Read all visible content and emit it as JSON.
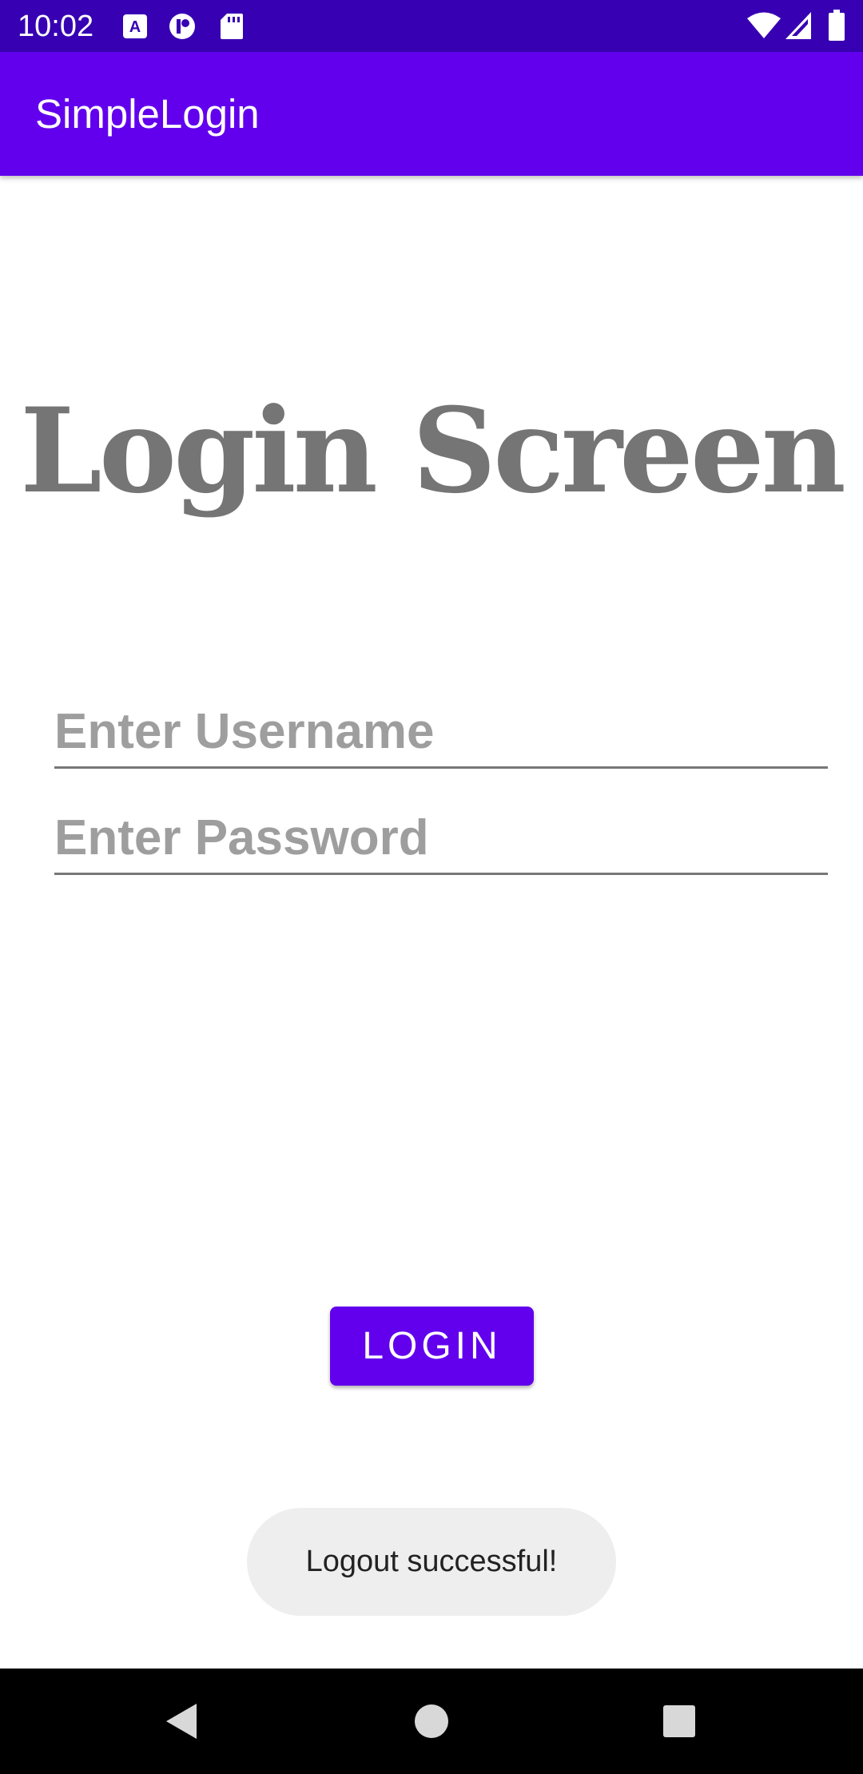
{
  "status_bar": {
    "time": "10:02",
    "left_icons": [
      "font-download-icon",
      "circle-badge-icon",
      "sd-card-icon"
    ],
    "right_icons": [
      "wifi-icon",
      "cell-signal-icon",
      "battery-icon"
    ]
  },
  "app_bar": {
    "title": "SimpleLogin",
    "color": "#6200ee"
  },
  "main": {
    "headline": "Login Screen",
    "username_placeholder": "Enter Username",
    "username_value": "",
    "password_placeholder": "Enter Password",
    "password_value": "",
    "login_label": "LOGIN"
  },
  "toast": {
    "message": "Logout successful!"
  },
  "nav_bar": {
    "buttons": [
      "back-icon",
      "home-icon",
      "recents-icon"
    ]
  },
  "colors": {
    "status_bar": "#3700b3",
    "primary": "#6200ee",
    "headline": "#757575"
  }
}
